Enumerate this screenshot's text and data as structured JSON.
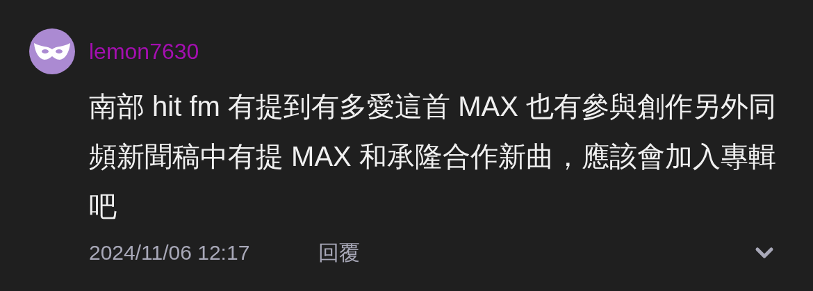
{
  "comment": {
    "author": "lemon7630",
    "text": "南部 hit fm 有提到有多愛這首 MAX 也有參與創作另外同頻新聞稿中有提 MAX 和承隆合作新曲，應該會加入專輯吧",
    "timestamp": "2024/11/06 12:17",
    "reply_label": "回覆",
    "expanded": false
  }
}
